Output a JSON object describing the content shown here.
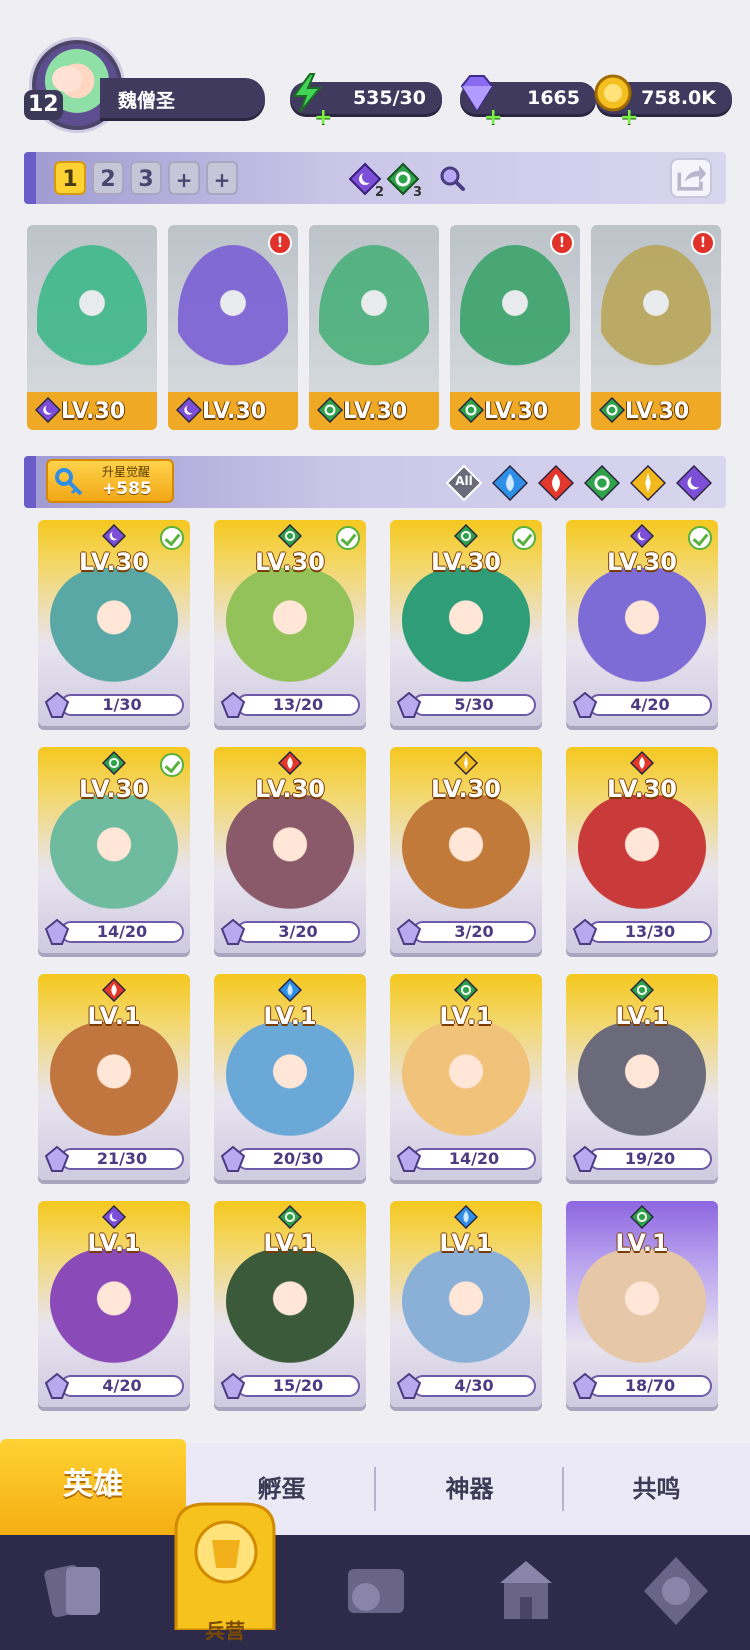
{
  "player": {
    "level": "12",
    "name": "魏僧圣"
  },
  "resources": [
    {
      "name": "energy",
      "value": "535/30",
      "color": "#41d456"
    },
    {
      "name": "gems",
      "value": "1665",
      "color": "#8a6cf0"
    },
    {
      "name": "gold",
      "value": "758.0K",
      "color": "#f4c020"
    }
  ],
  "team": {
    "slots": [
      "1",
      "2",
      "3",
      "+",
      "+"
    ],
    "active_slot": "1",
    "element_counts": [
      {
        "element": "dark",
        "count": "2"
      },
      {
        "element": "nature",
        "count": "3"
      }
    ]
  },
  "team_heroes": [
    {
      "level": "LV.30",
      "element": "dark",
      "alert": false,
      "art_color": "#3fb88a"
    },
    {
      "level": "LV.30",
      "element": "dark",
      "alert": true,
      "alert_text": "!",
      "art_color": "#7b5fd4"
    },
    {
      "level": "LV.30",
      "element": "nature",
      "alert": false,
      "art_color": "#4ab07a"
    },
    {
      "level": "LV.30",
      "element": "nature",
      "alert": true,
      "alert_text": "!",
      "art_color": "#3aa36a"
    },
    {
      "level": "LV.30",
      "element": "nature",
      "alert": true,
      "alert_text": "!",
      "art_color": "#b8a65a"
    }
  ],
  "awaken": {
    "label": "升星觉醒",
    "value": "+585"
  },
  "filters": [
    {
      "name": "all",
      "label": "All"
    },
    {
      "name": "water"
    },
    {
      "name": "fire"
    },
    {
      "name": "nature"
    },
    {
      "name": "light"
    },
    {
      "name": "dark"
    }
  ],
  "heroes": [
    {
      "level": "LV.30",
      "element": "dark",
      "shards": "1/30",
      "check": true,
      "art_color": "#5aa8a6"
    },
    {
      "level": "LV.30",
      "element": "nature",
      "shards": "13/20",
      "check": true,
      "art_color": "#93c25a"
    },
    {
      "level": "LV.30",
      "element": "nature",
      "shards": "5/30",
      "check": true,
      "art_color": "#2f9e78"
    },
    {
      "level": "LV.30",
      "element": "dark",
      "shards": "4/20",
      "check": true,
      "art_color": "#7d6bd6"
    },
    {
      "level": "LV.30",
      "element": "nature",
      "shards": "14/20",
      "check": true,
      "art_color": "#6fbba0"
    },
    {
      "level": "LV.30",
      "element": "fire",
      "shards": "3/20",
      "check": false,
      "art_color": "#8a5a6a"
    },
    {
      "level": "LV.30",
      "element": "light",
      "shards": "3/20",
      "check": false,
      "art_color": "#c27a3a"
    },
    {
      "level": "LV.30",
      "element": "fire",
      "shards": "13/30",
      "check": false,
      "art_color": "#c93a3a"
    },
    {
      "level": "LV.1",
      "element": "fire",
      "shards": "21/30",
      "check": false,
      "art_color": "#c2763f"
    },
    {
      "level": "LV.1",
      "element": "water",
      "shards": "20/30",
      "check": false,
      "art_color": "#6aa8d8"
    },
    {
      "level": "LV.1",
      "element": "nature",
      "shards": "14/20",
      "check": false,
      "art_color": "#f0c27a"
    },
    {
      "level": "LV.1",
      "element": "nature",
      "shards": "19/20",
      "check": false,
      "art_color": "#6a6a7a"
    },
    {
      "level": "LV.1",
      "element": "dark",
      "shards": "4/20",
      "check": false,
      "art_color": "#8a4ab8"
    },
    {
      "level": "LV.1",
      "element": "nature",
      "shards": "15/20",
      "check": false,
      "art_color": "#3a5a3a"
    },
    {
      "level": "LV.1",
      "element": "water",
      "shards": "4/30",
      "check": false,
      "art_color": "#8ab0d8"
    },
    {
      "level": "LV.1",
      "element": "nature",
      "shards": "18/70",
      "check": false,
      "art_color": "#e6c8a8",
      "purple": true
    }
  ],
  "tabs": {
    "active": "英雄",
    "items": [
      "孵蛋",
      "神器",
      "共鸣"
    ]
  },
  "bottom_nav": {
    "items": [
      "cards-icon",
      "barracks-icon",
      "scroll-icon",
      "shrine-icon",
      "guild-icon"
    ],
    "active_label": "兵营"
  },
  "element_colors": {
    "dark": "#7d4fd8",
    "nature": "#2fa34a",
    "fire": "#e2382b",
    "water": "#2f8fe6",
    "light": "#f2b81c"
  }
}
